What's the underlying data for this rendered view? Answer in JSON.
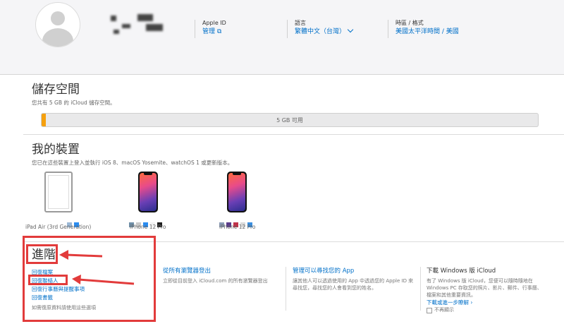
{
  "header": {
    "apple_id_label": "Apple ID",
    "apple_id_manage": "管理",
    "language_label": "語言",
    "language_value": "繁體中文（台灣）",
    "timezone_label": "時區 / 格式",
    "timezone_value": "美國太平洋時間 / 美國"
  },
  "storage": {
    "title": "儲存空間",
    "subtitle": "您共有 5 GB 的 iCloud 儲存空間。",
    "bar_label": "5 GB 可用",
    "used_color": "#f5a00e"
  },
  "devices": {
    "title": "我的裝置",
    "subtitle": "您已在這些裝置上登入並執行 iOS 8、macOS Yosemite、watchOS 1 或更新版本。",
    "items": [
      {
        "name": "iPad Air (3rd Generation)"
      },
      {
        "name": "iPhone 12 Pro"
      },
      {
        "name": "iPhone 12 Pro"
      }
    ]
  },
  "advanced": {
    "title": "進階",
    "restore_files": "回復檔案",
    "restore_contacts": "回復聯絡人",
    "restore_calendars": "回復行事曆與提醒事項",
    "restore_bookmarks": "回復書籤",
    "restore_note": "如需復原資料請使用這些選項"
  },
  "signout": {
    "title": "從所有瀏覽器登出",
    "desc": "立即從目前登入 iCloud.com 的所有瀏覽器登出"
  },
  "find": {
    "title": "管理可以尋找您的 App",
    "desc1": "讓其他人可以透過使用的 App 中透過您的 Apple ID 來",
    "desc2": "尋找您，尋找您的人會看到您的姓名。"
  },
  "windows": {
    "title": "下載 Windows 版 iCloud",
    "desc1": "有了 Windows 版 iCloud，您便可以隨時隨地在",
    "desc2": "Windows PC 存取您的照片、影片、郵件、行事曆、",
    "desc3": "檔案和其他重要資訊。",
    "link": "下載或進一步瞭解",
    "hide_label": "不再顯示"
  },
  "colors": {
    "link": "#0070c9",
    "annotation": "#e23b3b"
  }
}
